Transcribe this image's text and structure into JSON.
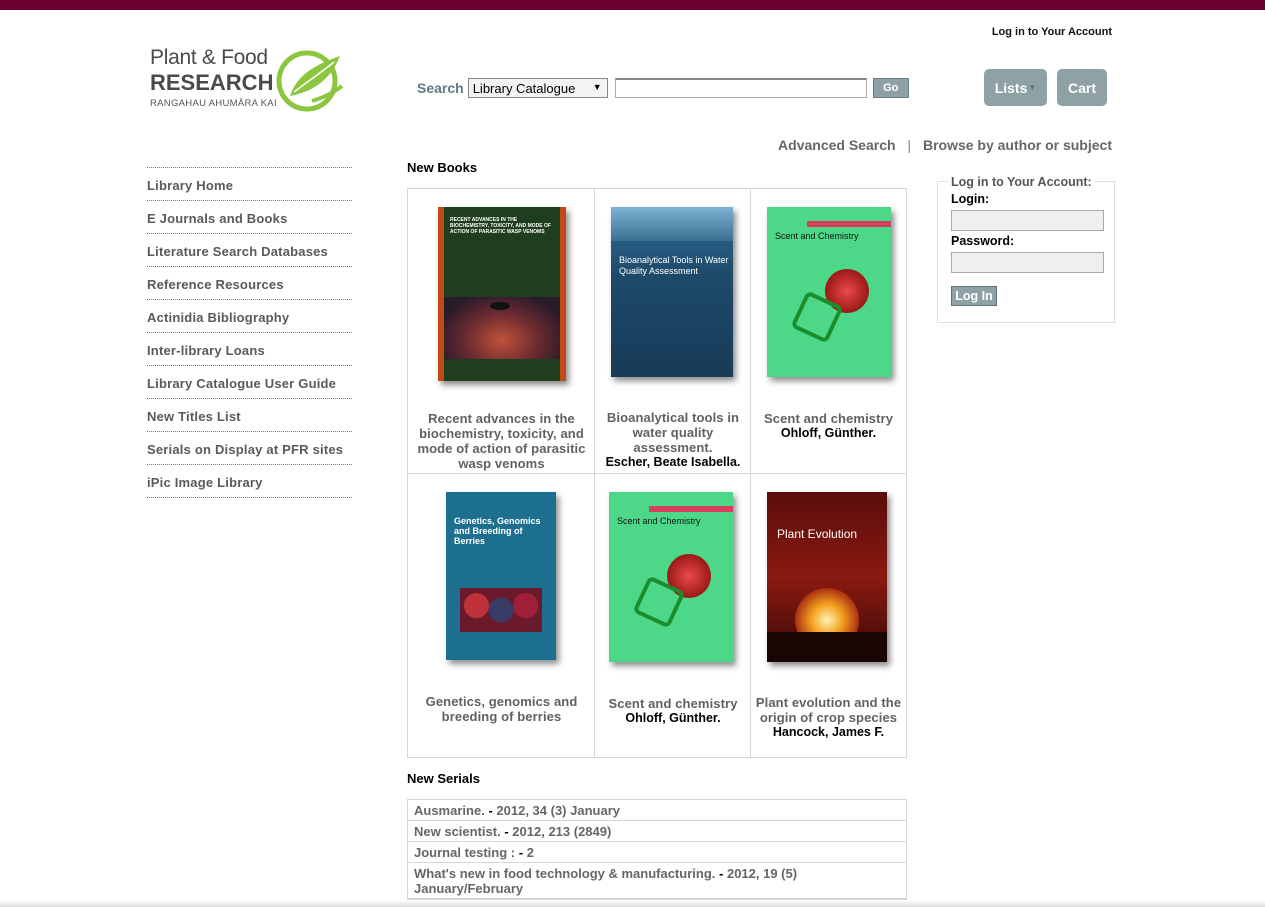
{
  "header": {
    "login_link": "Log in to Your Account",
    "logo": {
      "line1": "Plant & Food",
      "line2": "RESEARCH",
      "line3": "RANGAHAU AHUMĀRA KAI"
    },
    "search": {
      "label": "Search",
      "scope": "Library Catalogue",
      "input_value": "",
      "go_label": "Go"
    },
    "lists_label": "Lists",
    "cart_label": "Cart",
    "advanced_search": "Advanced Search",
    "separator": "|",
    "browse": "Browse by author or subject"
  },
  "nav": {
    "items": [
      "Library Home",
      "E Journals and Books",
      "Literature Search Databases",
      "Reference Resources",
      "Actinidia Bibliography",
      "Inter-library Loans",
      "Library Catalogue User Guide",
      "New Titles List",
      "Serials on Display at PFR sites",
      "iPic Image Library"
    ]
  },
  "new_books": {
    "title": "New Books",
    "books": [
      {
        "title": "Recent advances in the biochemistry, toxicity, and mode of action of parasitic wasp venoms",
        "author": "",
        "cover_text": "RECENT ADVANCES IN THE BIOCHEMISTRY, TOXICITY, AND MODE OF ACTION OF PARASITIC WASP VENOMS"
      },
      {
        "title": "Bioanalytical tools in water quality assessment.",
        "author": "Escher, Beate Isabella.",
        "cover_text": "Bioanalytical Tools in Water Quality Assessment"
      },
      {
        "title": "Scent and chemistry",
        "author": "Ohloff, Günther.",
        "cover_text": "Scent and Chemistry"
      },
      {
        "title": "Genetics, genomics and breeding of berries",
        "author": "",
        "cover_text": "Genetics, Genomics and Breeding of Berries"
      },
      {
        "title": "Scent and chemistry",
        "author": "Ohloff, Günther.",
        "cover_text": "Scent and Chemistry"
      },
      {
        "title": "Plant evolution and the origin of crop species",
        "author": "Hancock, James F.",
        "cover_text": "Plant Evolution"
      }
    ]
  },
  "new_serials": {
    "title": "New Serials",
    "rows": [
      {
        "name": "Ausmarine.",
        "sep": "-",
        "issue": "2012, 34 (3) January"
      },
      {
        "name": "New scientist.",
        "sep": "-",
        "issue": "2012, 213 (2849)"
      },
      {
        "name": "Journal testing :",
        "sep": "-",
        "issue": "2"
      },
      {
        "name": "What's new in food technology & manufacturing.",
        "sep": "-",
        "issue": "2012, 19 (5) January/February"
      }
    ]
  },
  "login": {
    "legend": "Log in to Your Account:",
    "login_label": "Login:",
    "password_label": "Password:",
    "login_value": "",
    "password_value": "",
    "button": "Log In"
  },
  "colors": {
    "topbar": "#6b0030",
    "button_grey": "#8ea2a6",
    "search_label": "#5f7a82"
  }
}
